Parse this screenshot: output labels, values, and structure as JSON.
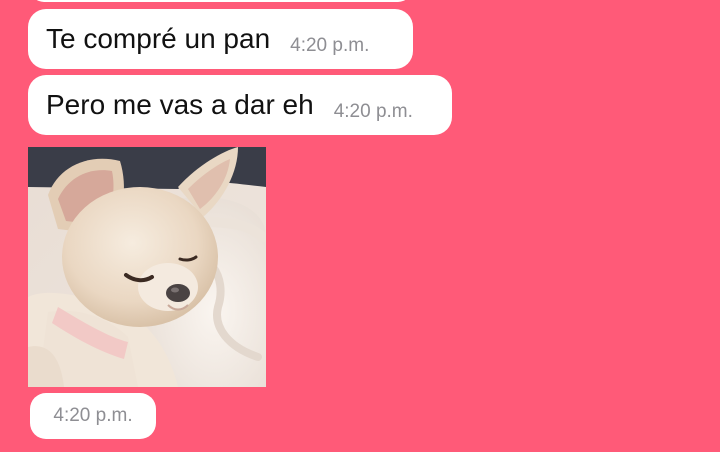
{
  "chat": {
    "messages": [
      {
        "text": "Te compré un pan",
        "time": "4:20 p.m."
      },
      {
        "text": "Pero me vas a dar eh",
        "time": "4:20 p.m."
      }
    ],
    "photo": {
      "time": "4:20 p.m."
    }
  },
  "colors": {
    "background": "#ff5a78",
    "bubble": "#ffffff",
    "text": "#111111",
    "timestamp": "#8e8e93"
  }
}
